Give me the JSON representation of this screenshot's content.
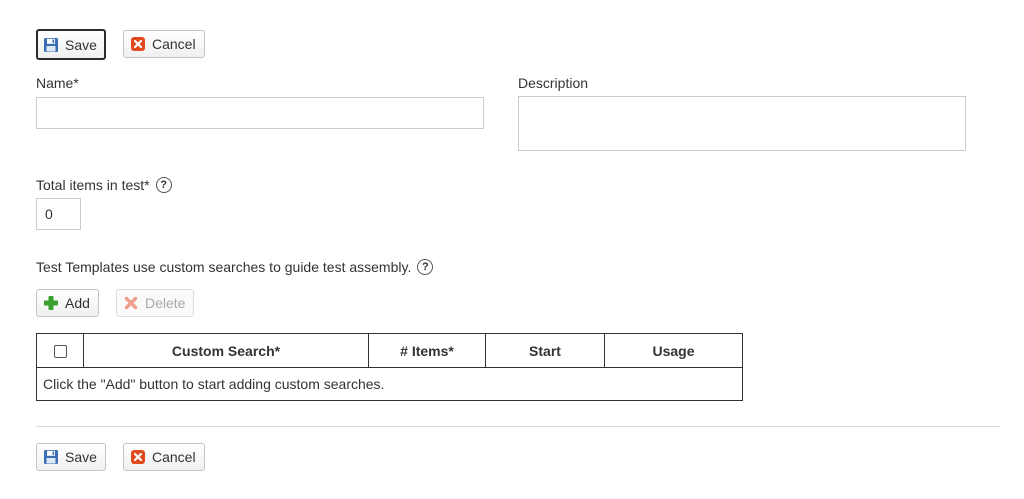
{
  "toolbar_top": {
    "save_label": "Save",
    "cancel_label": "Cancel"
  },
  "form": {
    "name_label": "Name*",
    "name_value": "",
    "description_label": "Description",
    "description_value": "",
    "total_items_label": "Total items in test*",
    "total_items_value": "0",
    "help_glyph": "?",
    "custom_search_note": "Test Templates use custom searches to guide test assembly."
  },
  "grid_toolbar": {
    "add_label": "Add",
    "delete_label": "Delete"
  },
  "table": {
    "columns": [
      "",
      "Custom Search*",
      "# Items*",
      "Start",
      "Usage"
    ],
    "empty_message": "Click the \"Add\" button to start adding custom searches."
  },
  "toolbar_bottom": {
    "save_label": "Save",
    "cancel_label": "Cancel"
  },
  "icons": {
    "save": "floppy-disk-icon",
    "cancel": "red-x-icon",
    "add": "green-plus-icon",
    "delete": "faded-red-x-icon",
    "help": "question-mark-icon"
  },
  "colors": {
    "save_icon": "#3a6fb5",
    "cancel_icon": "#e04a1f",
    "add_icon": "#3aa02f",
    "delete_icon": "#f0a08a",
    "table_border": "#333333"
  }
}
